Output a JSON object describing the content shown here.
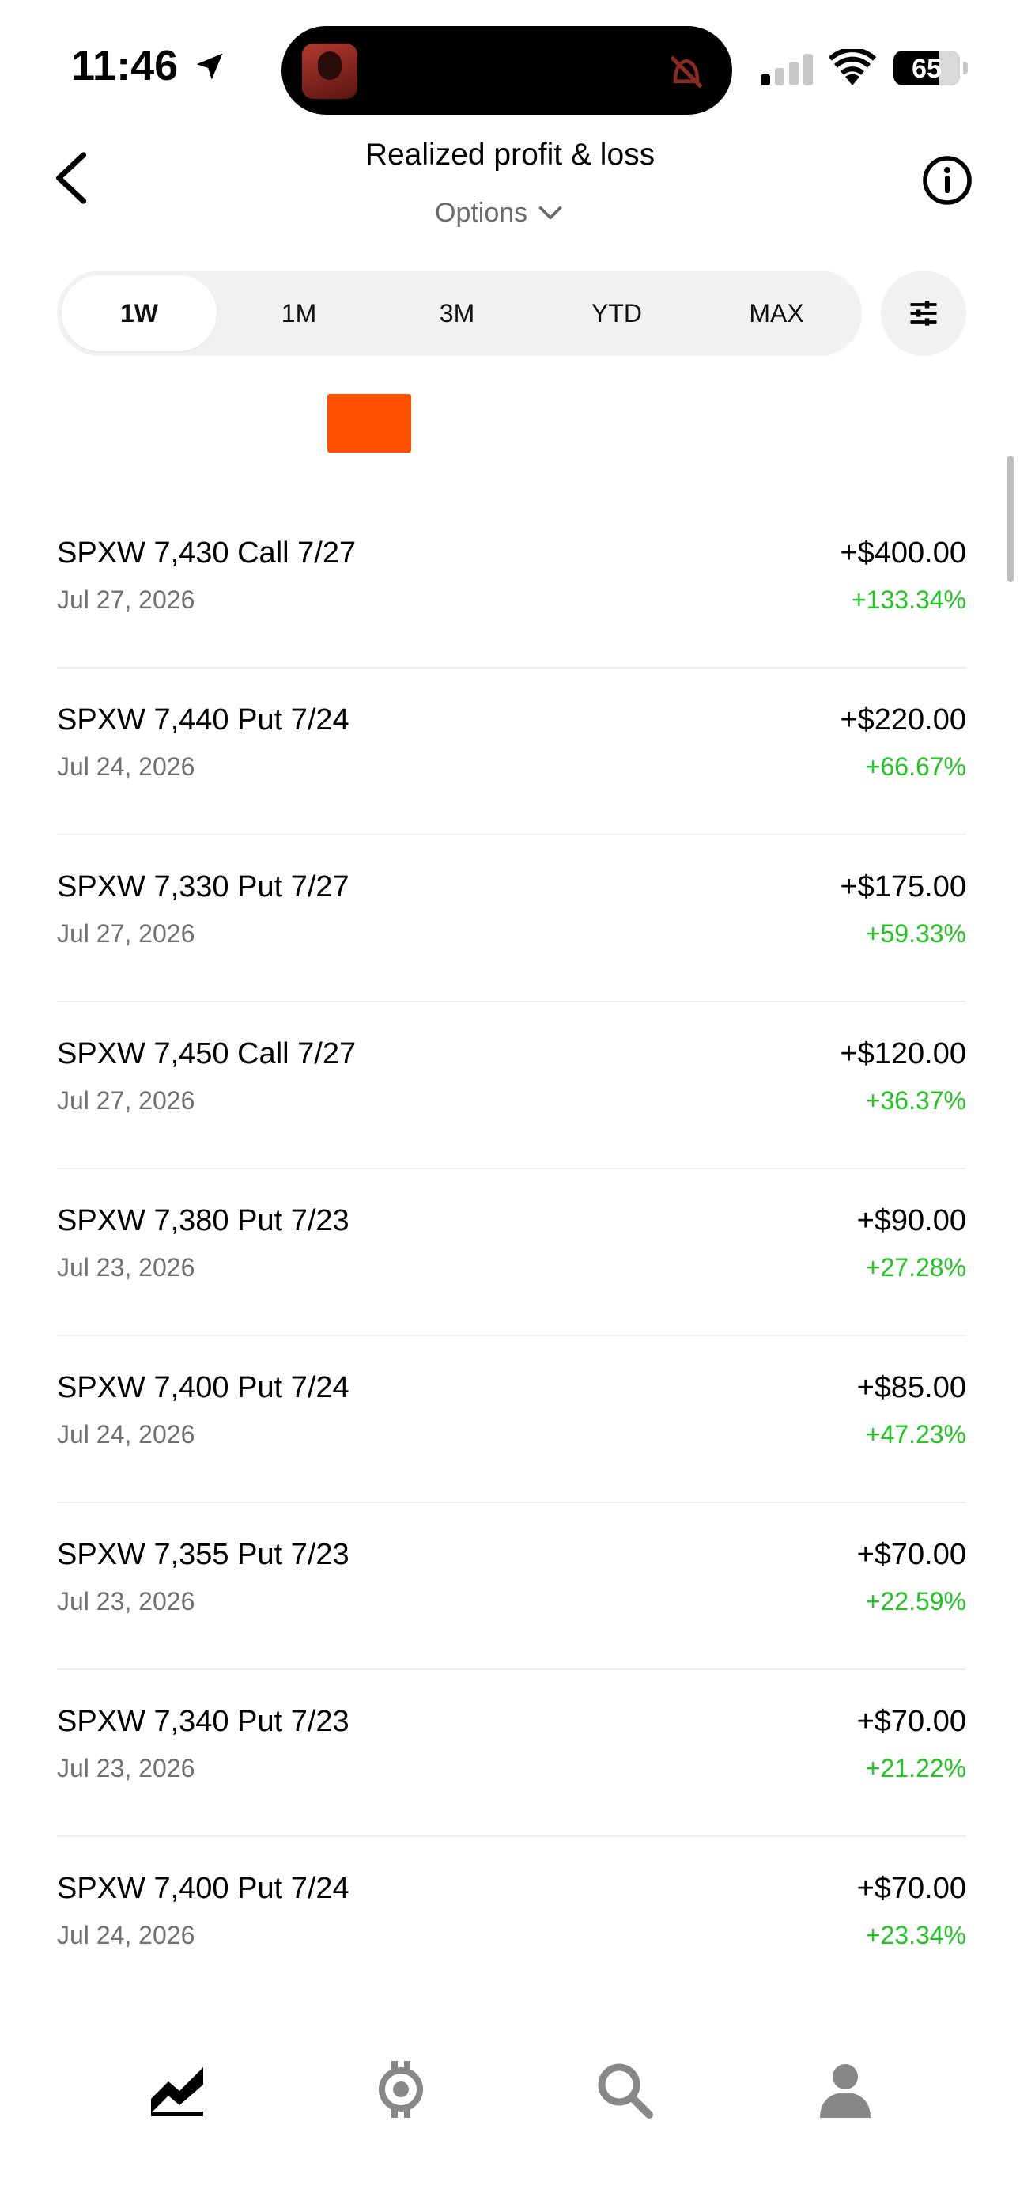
{
  "status_bar": {
    "time": "11:46",
    "battery": "65",
    "icons": [
      "location-arrow-icon",
      "silent-mode-icon",
      "cellular-signal-icon",
      "wifi-icon",
      "battery-icon"
    ]
  },
  "header": {
    "title": "Realized profit & loss",
    "account_selector": "Options",
    "icons": [
      "back-chevron-icon",
      "chevron-down-icon",
      "info-icon"
    ]
  },
  "range_tabs": {
    "items": [
      {
        "label": "1W",
        "active": true
      },
      {
        "label": "1M",
        "active": false
      },
      {
        "label": "3M",
        "active": false
      },
      {
        "label": "YTD",
        "active": false
      },
      {
        "label": "MAX",
        "active": false
      }
    ],
    "filter_icon": "sliders-icon"
  },
  "colors": {
    "accent": "#ff5000",
    "positive": "#21c521",
    "secondary_text": "#707070",
    "divider": "#ededed",
    "tab_background": "#f1f1f1"
  },
  "positions": [
    {
      "name": "SPXW 7,430 Call 7/27",
      "date": "Jul 27, 2026",
      "amount": "+$400.00",
      "percent": "+133.34%"
    },
    {
      "name": "SPXW 7,440 Put 7/24",
      "date": "Jul 24, 2026",
      "amount": "+$220.00",
      "percent": "+66.67%"
    },
    {
      "name": "SPXW 7,330 Put 7/27",
      "date": "Jul 27, 2026",
      "amount": "+$175.00",
      "percent": "+59.33%"
    },
    {
      "name": "SPXW 7,450 Call 7/27",
      "date": "Jul 27, 2026",
      "amount": "+$120.00",
      "percent": "+36.37%"
    },
    {
      "name": "SPXW 7,380 Put 7/23",
      "date": "Jul 23, 2026",
      "amount": "+$90.00",
      "percent": "+27.28%"
    },
    {
      "name": "SPXW 7,400 Put 7/24",
      "date": "Jul 24, 2026",
      "amount": "+$85.00",
      "percent": "+47.23%"
    },
    {
      "name": "SPXW 7,355 Put 7/23",
      "date": "Jul 23, 2026",
      "amount": "+$70.00",
      "percent": "+22.59%"
    },
    {
      "name": "SPXW 7,340 Put 7/23",
      "date": "Jul 23, 2026",
      "amount": "+$70.00",
      "percent": "+21.22%"
    },
    {
      "name": "SPXW 7,400 Put 7/24",
      "date": "Jul 24, 2026",
      "amount": "+$70.00",
      "percent": "+23.34%"
    }
  ],
  "bottom_nav": {
    "items": [
      {
        "icon": "investing-chart-icon",
        "active": true
      },
      {
        "icon": "crypto-icon",
        "active": false
      },
      {
        "icon": "search-icon",
        "active": false
      },
      {
        "icon": "account-person-icon",
        "active": false
      }
    ]
  }
}
